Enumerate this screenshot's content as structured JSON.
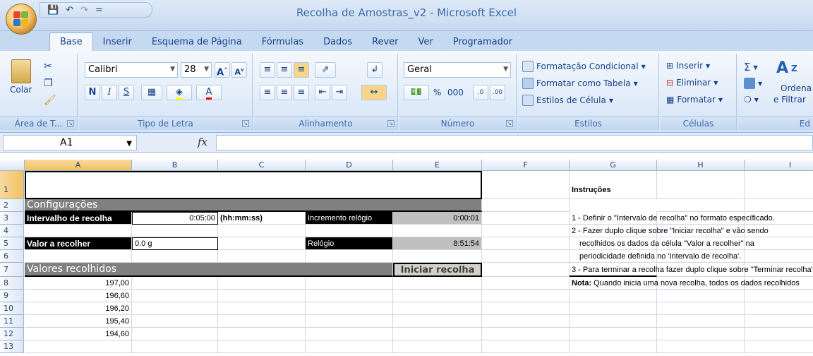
{
  "window": {
    "title": "Recolha de Amostras_v2 - Microsoft Excel"
  },
  "quick_access": {
    "save_icon": "save-icon",
    "undo_icon": "undo-icon",
    "redo_icon": "redo-icon",
    "more": "="
  },
  "tabs": [
    {
      "label": "Base",
      "active": true
    },
    {
      "label": "Inserir"
    },
    {
      "label": "Esquema de Página"
    },
    {
      "label": "Fórmulas"
    },
    {
      "label": "Dados"
    },
    {
      "label": "Rever"
    },
    {
      "label": "Ver"
    },
    {
      "label": "Programador"
    }
  ],
  "ribbon": {
    "clipboard": {
      "paste": "Colar",
      "label": "Área de T..."
    },
    "font": {
      "name": "Calibri",
      "size": "28",
      "bold": "N",
      "italic": "I",
      "underline": "S",
      "label": "Tipo de Letra"
    },
    "alignment": {
      "label": "Alinhamento"
    },
    "number": {
      "format": "Geral",
      "percent": "%",
      "thousands": "000",
      "label": "Número"
    },
    "styles": {
      "conditional": "Formatação Condicional",
      "as_table": "Formatar como Tabela",
      "cell_styles": "Estilos de Célula",
      "label": "Estilos"
    },
    "cells": {
      "insert": "Inserir",
      "delete": "Eliminar",
      "format": "Formatar",
      "label": "Células"
    },
    "editing": {
      "sort": "Ordena",
      "filter": "e Filtrar",
      "label": "Ed"
    }
  },
  "formula_bar": {
    "name_box": "A1",
    "fx": "fx",
    "content": ""
  },
  "columns": [
    "A",
    "B",
    "C",
    "D",
    "E",
    "F",
    "G",
    "H",
    "I"
  ],
  "rows": [
    "1",
    "2",
    "3",
    "4",
    "5",
    "6",
    "7",
    "8",
    "9",
    "10",
    "11",
    "12",
    "13"
  ],
  "sheet": {
    "config_header": "Configurações",
    "interval_label": "Intervalho de recolha",
    "interval_value": "0:05:00",
    "interval_format": "(hh:mm:ss)",
    "increment_label": "Incremento relógio",
    "increment_value": "0:00:01",
    "value_label": "Valor a recolher",
    "value_value": "0.0 g",
    "clock_label": "Relógio",
    "clock_value": "8:51:54",
    "collected_header": "Valores recolhidos",
    "start_button": "Iniciar recolha",
    "values": [
      "197,00",
      "196,60",
      "196,20",
      "195,40",
      "194,60"
    ]
  },
  "instructions": {
    "title": "Instruções",
    "line1": "1 - Definir o \"Intervalo de recolha\" no formato específicado.",
    "line2": "2 - Fazer duplo clique sobre \"Iniciar recolha\" e vão sendo",
    "line3": "recolhidos os dados da célula \"Valor a recolher\" na",
    "line4": "periodicidade definida no 'Intervalo de recolha'.",
    "line5": "3 - Para terminar a recolha fazer duplo clique sobre \"Terminar recolha\"",
    "note_label": "Nota:",
    "note_text": " Quando inicia uma nova recolha, todos os dados recolhidos"
  }
}
